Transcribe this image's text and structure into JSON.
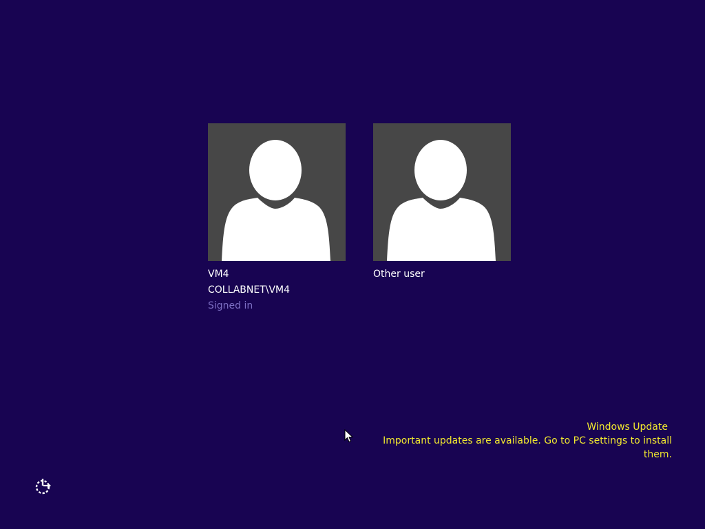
{
  "users": [
    {
      "name": "VM4",
      "domain": "COLLABNET\\VM4",
      "status": "Signed in",
      "icon": "user-avatar-icon"
    },
    {
      "name": "Other user",
      "icon": "user-avatar-icon"
    }
  ],
  "notification": {
    "title": "Windows Update",
    "message": "Important updates are available. Go to PC settings to install them."
  },
  "ease_of_access": {
    "icon": "ease-of-access-icon"
  },
  "colors": {
    "background": "#180452",
    "tile": "#474747",
    "status_text": "#7d6fc4",
    "notification_text": "#f2e82e"
  }
}
